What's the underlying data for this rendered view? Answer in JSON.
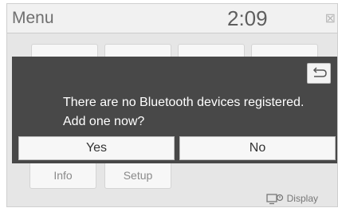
{
  "header": {
    "title": "Menu",
    "time": "2:09"
  },
  "background": {
    "tiles": [
      "Info",
      "Setup"
    ],
    "display_label": "Display",
    "display_icon": "display-icon"
  },
  "dialog": {
    "message_line1": "There are no Bluetooth devices registered.",
    "message_line2": "Add one now?",
    "back_icon": "return-arrow-icon",
    "yes_label": "Yes",
    "no_label": "No"
  },
  "colors": {
    "overlay": "#484848",
    "header_bg": "#f1f1f1",
    "button_bg": "#f7f7f7"
  }
}
